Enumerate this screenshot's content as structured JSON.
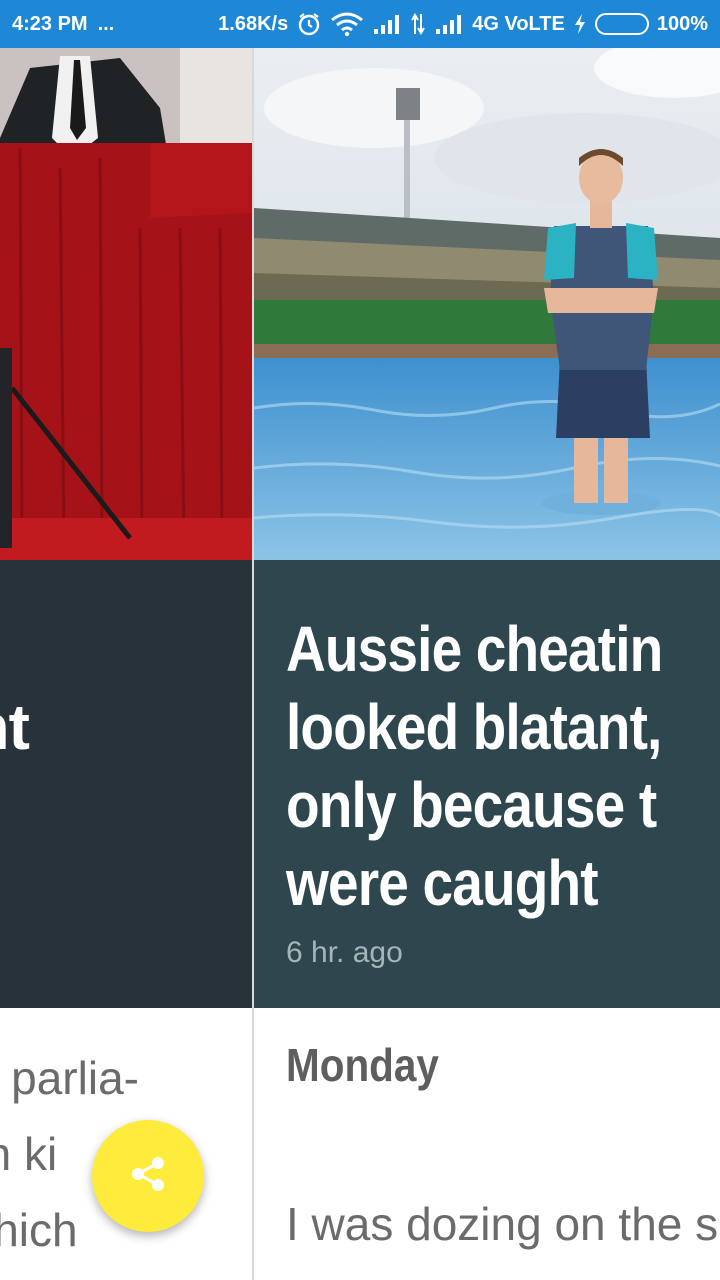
{
  "status_bar": {
    "time": "4:23 PM",
    "dots": "...",
    "speed": "1.68K/s",
    "network": "4G VoLTE",
    "battery": "100%",
    "icons": [
      "alarm-icon",
      "wifi-icon",
      "signal-icon",
      "data-arrows-icon",
      "signal-icon",
      "charging-bolt-icon",
      "battery-icon"
    ]
  },
  "left_card": {
    "headline": "an\nment\na to",
    "body": "to parlia-\nan ki\nwhich"
  },
  "right_card": {
    "headline": "Aussie cheatin\nlooked blatant,\nonly because t\nwere caught",
    "timestamp": "6 hr. ago",
    "section_title": "Monday",
    "body": "I was dozing on the s"
  },
  "fab": {
    "icon": "share-icon"
  },
  "colors": {
    "status_bar": "#1e88d6",
    "left_headline_bg": "#27323a",
    "right_headline_bg": "#2e474f",
    "fab": "#ffeb3b"
  }
}
